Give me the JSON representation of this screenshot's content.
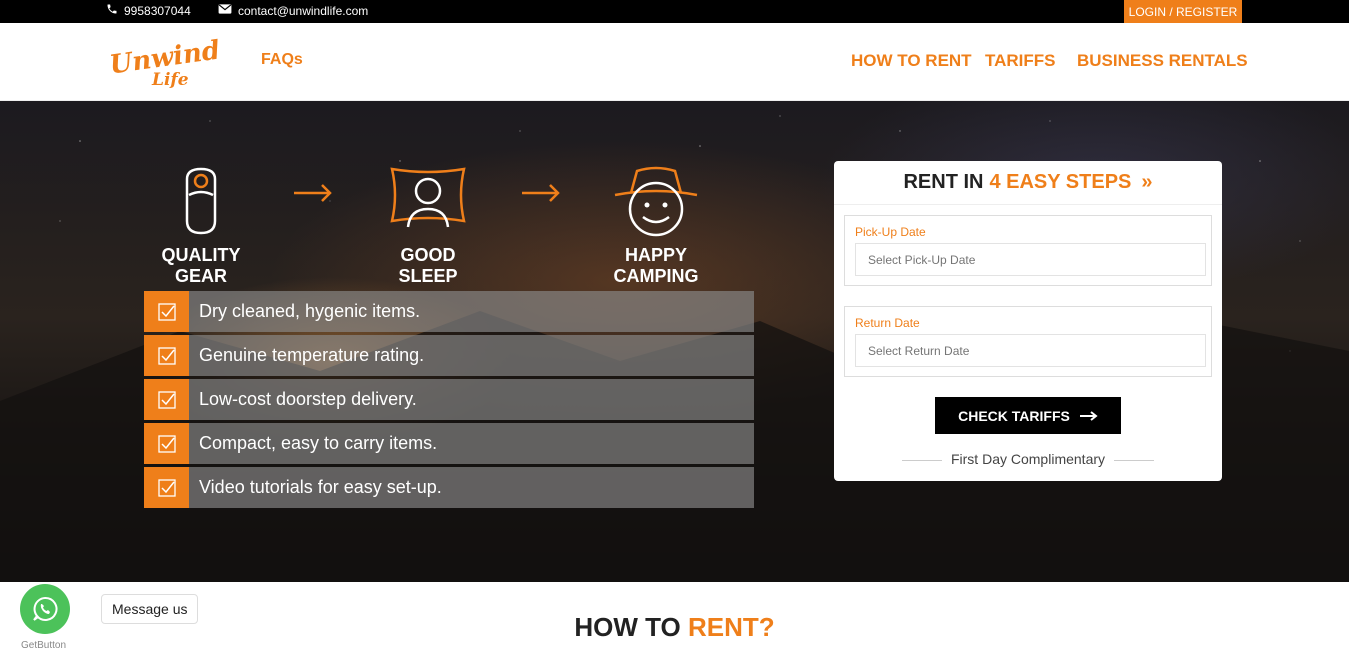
{
  "topbar": {
    "phone": "9958307044",
    "email": "contact@unwindlife.com",
    "login": "LOGIN / REGISTER"
  },
  "header": {
    "logo_text": "Unwind Life",
    "faqs": "FAQs",
    "nav": [
      "HOW TO RENT",
      "TARIFFS",
      "BUSINESS RENTALS"
    ]
  },
  "hero": {
    "steps": [
      "QUALITY GEAR",
      "GOOD SLEEP",
      "HAPPY CAMPING"
    ],
    "features": [
      "Dry cleaned, hygenic items.",
      "Genuine temperature rating.",
      "Low-cost doorstep delivery.",
      "Compact, easy to carry items.",
      "Video tutorials for easy set-up."
    ]
  },
  "form": {
    "title": "RENT IN",
    "title_accent": "4 EASY STEPS",
    "pickup_label": "Pick-Up Date",
    "pickup_placeholder": "Select Pick-Up Date",
    "return_label": "Return Date",
    "return_placeholder": "Select Return Date",
    "cta": "CHECK TARIFFS",
    "note": "First Day Complimentary"
  },
  "bottom": {
    "how_title": "HOW TO",
    "how_accent": "RENT?",
    "message_us": "Message us",
    "getbutton": "GetButton"
  },
  "colors": {
    "accent": "#ef7f1a",
    "whatsapp": "#4cc25a"
  }
}
